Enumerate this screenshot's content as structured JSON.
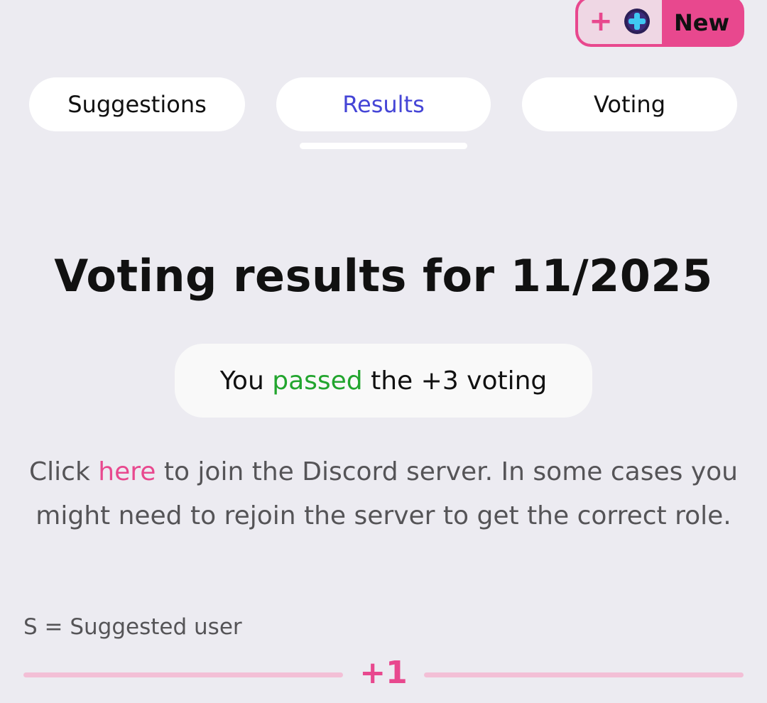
{
  "new_button": {
    "plus_glyph": "+",
    "label": "New"
  },
  "tabs": [
    {
      "label": "Suggestions",
      "active": false
    },
    {
      "label": "Results",
      "active": true
    },
    {
      "label": "Voting",
      "active": false
    }
  ],
  "heading": "Voting results for 11/2025",
  "result": {
    "prefix": "You",
    "status": "passed",
    "suffix": "the +3 voting"
  },
  "info": {
    "before_link": "Click",
    "link_text": "here",
    "after_link": "to join the Discord server. In some cases you might need to rejoin the server to get the correct role."
  },
  "legend": "S = Suggested user",
  "section_label": "+1",
  "colors": {
    "accent_pink": "#e8488e",
    "active_tab": "#4545d6",
    "passed_green": "#22a52e",
    "background": "#ecebf1"
  }
}
